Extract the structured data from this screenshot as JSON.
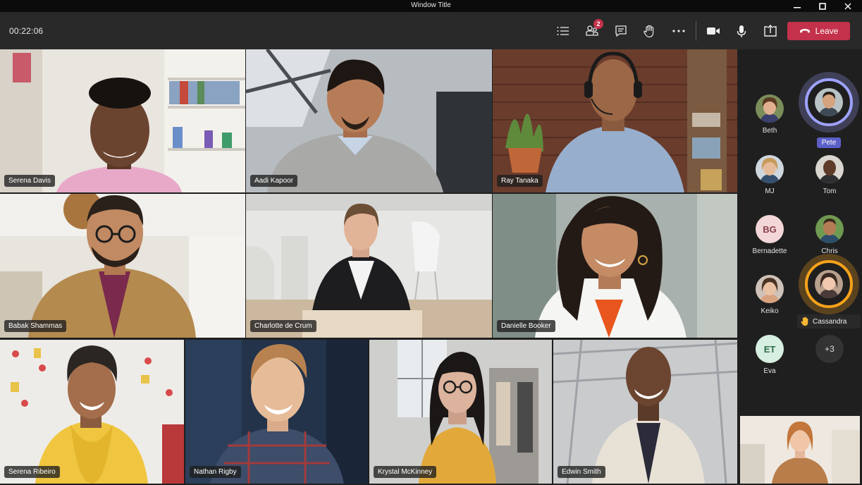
{
  "window": {
    "title": "Window Title"
  },
  "toolbar": {
    "timer": "00:22:06",
    "participants_badge": "2",
    "leave_label": "Leave"
  },
  "tiles": [
    {
      "name": "Serena Davis"
    },
    {
      "name": "Aadi Kapoor"
    },
    {
      "name": "Ray Tanaka"
    },
    {
      "name": "Babak Shammas"
    },
    {
      "name": "Charlotte de Crum"
    },
    {
      "name": "Danielle Booker"
    },
    {
      "name": "Serena Ribeiro"
    },
    {
      "name": "Nathan Rigby"
    },
    {
      "name": "Krystal McKinney"
    },
    {
      "name": "Edwin Smith"
    }
  ],
  "roster": {
    "beth": "Beth",
    "pete": "Pete",
    "mj": "MJ",
    "tom": "Tom",
    "bernadette": "Bernadette",
    "bernadette_initials": "BG",
    "chris": "Chris",
    "keiko": "Keiko",
    "cassandra": "Cassandra",
    "eva": "Eva",
    "eva_initials": "ET",
    "more": "+3"
  },
  "colors": {
    "leave": "#c4314b",
    "speaking_ring": "#9ea2ff",
    "raised_hand_ring": "#f7a21b"
  }
}
